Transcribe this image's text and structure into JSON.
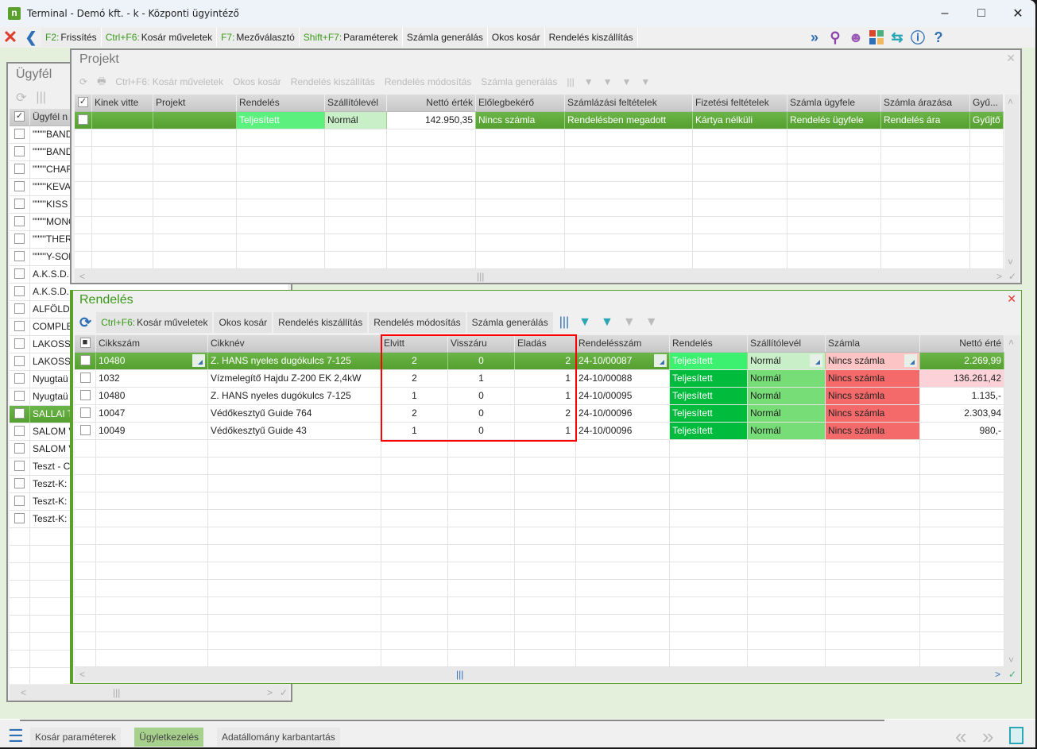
{
  "window": {
    "title": "Terminal - Demó kft. - k - Központi ügyintéző",
    "app_icon": "n"
  },
  "toolbar": {
    "items": [
      {
        "key": "F2:",
        "label": "Frissítés"
      },
      {
        "key": "Ctrl+F6:",
        "label": "Kosár műveletek"
      },
      {
        "key": "F7:",
        "label": "Mezőválasztó"
      },
      {
        "key": "Shift+F7:",
        "label": "Paraméterek"
      },
      {
        "key": "",
        "label": "Számla generálás"
      },
      {
        "key": "",
        "label": "Okos kosár"
      },
      {
        "key": "",
        "label": "Rendelés kiszállítás"
      }
    ],
    "right_icons": [
      "forward-icon",
      "search-icon",
      "user-icon",
      "tiles-icon",
      "swap-icon",
      "info-icon",
      "help-icon"
    ]
  },
  "ugyfel": {
    "title": "Ügyfél",
    "header": "Ügyfél n",
    "rows": [
      "\"\"\"\"BAND",
      "\"\"\"\"BAND",
      "\"\"\"\"CHAR",
      "\"\"\"\"KEVAI",
      "\"\"\"\"KISS K",
      "\"\"\"\"MONO",
      "\"\"\"\"THER",
      "\"\"\"\"Y-SOF",
      "A.K.S.D.",
      "A.K.S.D.",
      "ALFÖLD",
      "COMPLE",
      "LAKOSS",
      "LAKOSS",
      "Nyugtaü",
      "Nyugtaü",
      "SALLAI T",
      "SALOM V",
      "SALOM V",
      "Teszt - C",
      "Teszt-K:",
      "Teszt-K:",
      "Teszt-K:"
    ],
    "selected_index": 16
  },
  "projekt": {
    "title": "Projekt",
    "tools": [
      "Ctrl+F6: Kosár műveletek",
      "Okos kosár",
      "Rendelés kiszállítás",
      "Rendelés módosítás",
      "Számla generálás"
    ],
    "columns": [
      "",
      "Kinek vitte",
      "Projekt",
      "Rendelés",
      "Szállítólevél",
      "Nettó érték",
      "Előlegbekérő",
      "Számlázási feltételek",
      "Fizetési feltételek",
      "Számla ügyfele",
      "Számla árazása",
      "Gyű..."
    ],
    "rows": [
      [
        "✓",
        "",
        "",
        "Teljesített",
        "Normál",
        "142.950,35",
        "Nincs számla",
        "Rendelésben megadott",
        "Kártya nélküli",
        "Rendelés ügyfele",
        "Rendelés ára",
        "Gyűjtő"
      ]
    ]
  },
  "rendeles": {
    "title": "Rendelés",
    "tools": [
      {
        "key": "Ctrl+F6:",
        "label": "Kosár műveletek"
      },
      {
        "key": "",
        "label": "Okos kosár"
      },
      {
        "key": "",
        "label": "Rendelés kiszállítás"
      },
      {
        "key": "",
        "label": "Rendelés módosítás"
      },
      {
        "key": "",
        "label": "Számla generálás"
      }
    ],
    "columns": [
      "■",
      "Cikkszám",
      "Cikknév",
      "Elvitt",
      "Visszáru",
      "Eladás",
      "Rendelésszám",
      "Rendelés",
      "Szállítólevél",
      "Számla",
      "Nettó érté"
    ],
    "rows": [
      [
        "",
        "10480",
        "Z. HANS nyeles dugókulcs 7-125",
        "2",
        "0",
        "2",
        "24-10/00087",
        "Teljesített",
        "Normál",
        "Nincs számla",
        "2.269,99"
      ],
      [
        "",
        "1032",
        "Vízmelegítő Hajdu Z-200 EK 2,4kW",
        "2",
        "1",
        "1",
        "24-10/00088",
        "Teljesített",
        "Normál",
        "Nincs számla",
        "136.261,42"
      ],
      [
        "",
        "10480",
        "Z. HANS nyeles dugókulcs 7-125",
        "1",
        "0",
        "1",
        "24-10/00095",
        "Teljesített",
        "Normál",
        "Nincs számla",
        "1.135,-"
      ],
      [
        "",
        "10047",
        "Védőkesztyű Guide 764",
        "2",
        "0",
        "2",
        "24-10/00096",
        "Teljesített",
        "Normál",
        "Nincs számla",
        "2.303,94"
      ],
      [
        "",
        "10049",
        "Védőkesztyű Guide 43",
        "1",
        "0",
        "1",
        "24-10/00096",
        "Teljesített",
        "Normál",
        "Nincs számla",
        "980,-"
      ]
    ],
    "highlight_columns": [
      "Elvitt",
      "Visszáru",
      "Eladás"
    ]
  },
  "colors": {
    "accent_green": "#5aa02c",
    "status_done": "#00bb3c",
    "status_normal": "#77dd77",
    "status_no_invoice": "#f46a6a",
    "highlight_box": "#ff0000"
  },
  "bottom_tabs": [
    "Kosár paraméterek",
    "Ügyletkezelés",
    "Adatállomány karbantartás"
  ],
  "active_bottom_tab": "Ügyletkezelés"
}
